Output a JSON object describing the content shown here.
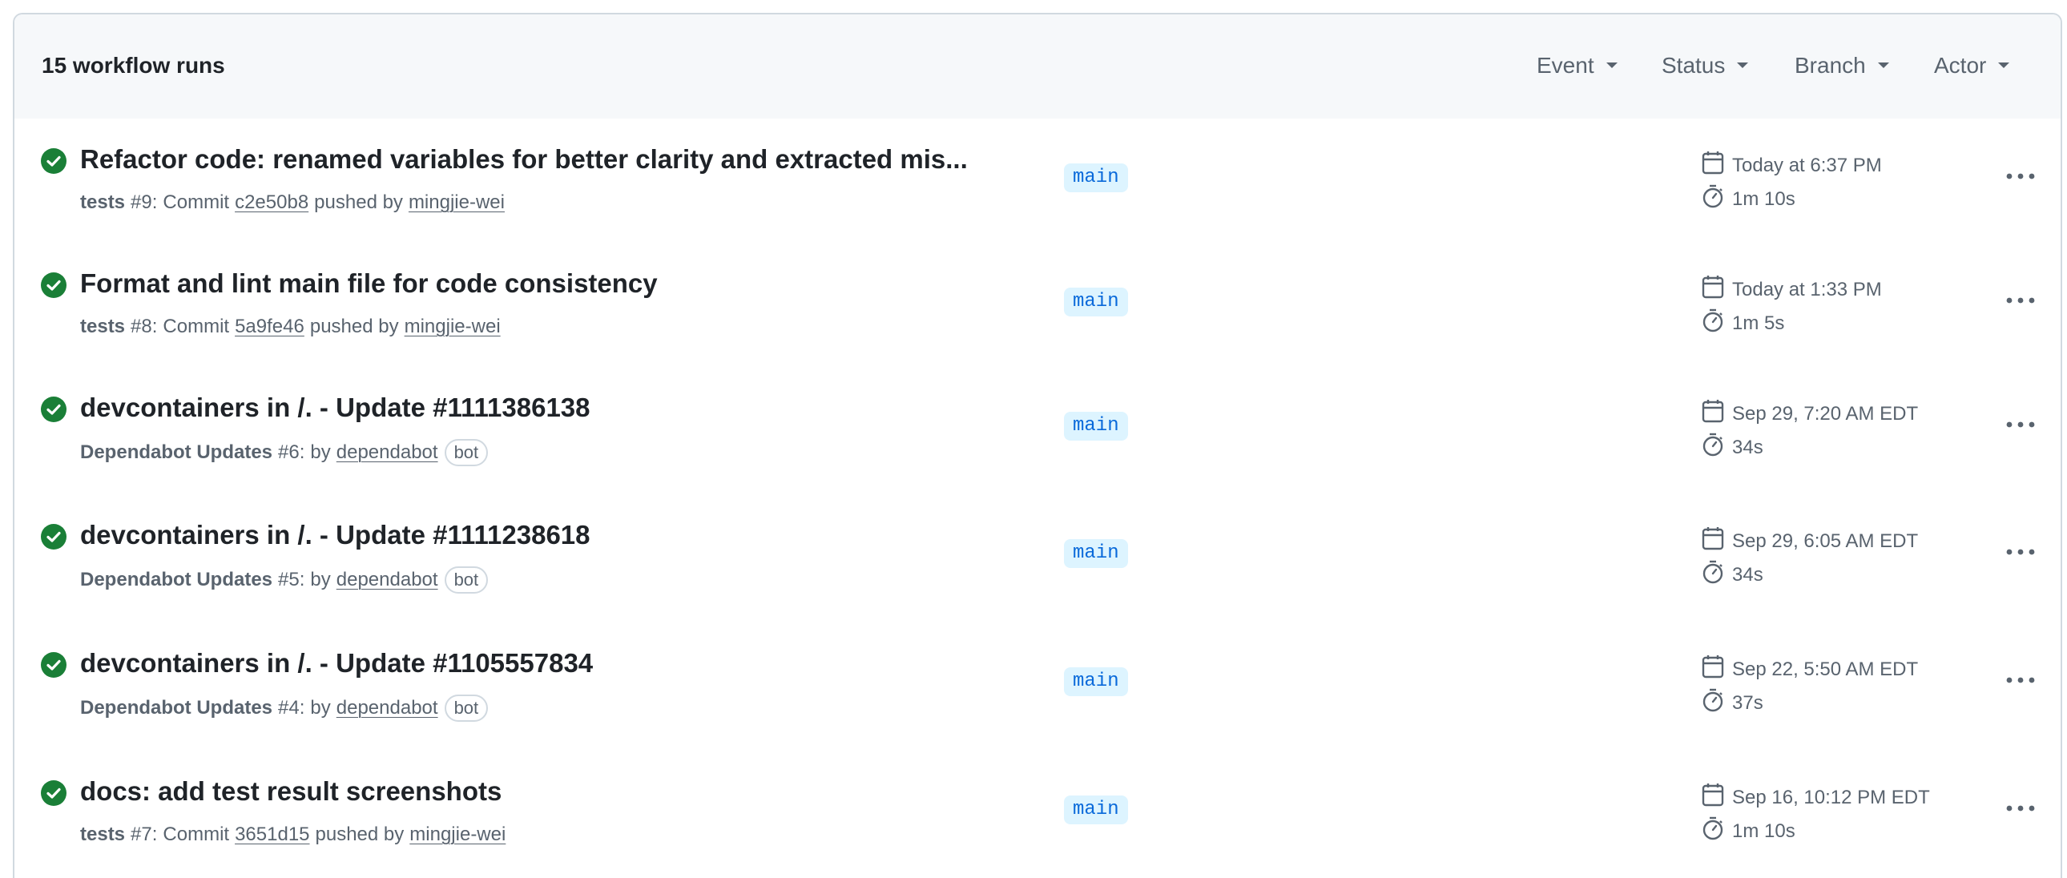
{
  "header": {
    "runs_count": "15 workflow runs",
    "filters": [
      "Event",
      "Status",
      "Branch",
      "Actor"
    ]
  },
  "runs": [
    {
      "title": "Refactor code: renamed variables for better clarity and extracted mis...",
      "workflow": "tests",
      "run_number": "#9",
      "trigger": "Commit",
      "commit": "c2e50b8",
      "action": "pushed by",
      "actor": "mingjie-wei",
      "branch": "main",
      "date": "Today at 6:37 PM",
      "duration": "1m 10s"
    },
    {
      "title": "Format and lint main file for code consistency",
      "workflow": "tests",
      "run_number": "#8",
      "trigger": "Commit",
      "commit": "5a9fe46",
      "action": "pushed by",
      "actor": "mingjie-wei",
      "branch": "main",
      "date": "Today at 1:33 PM",
      "duration": "1m 5s"
    },
    {
      "title": "devcontainers in /. - Update #1111386138",
      "workflow": "Dependabot Updates",
      "run_number": "#6",
      "action": "by",
      "actor": "dependabot",
      "badge": "bot",
      "branch": "main",
      "date": "Sep 29, 7:20 AM EDT",
      "duration": "34s"
    },
    {
      "title": "devcontainers in /. - Update #1111238618",
      "workflow": "Dependabot Updates",
      "run_number": "#5",
      "action": "by",
      "actor": "dependabot",
      "badge": "bot",
      "branch": "main",
      "date": "Sep 29, 6:05 AM EDT",
      "duration": "34s"
    },
    {
      "title": "devcontainers in /. - Update #1105557834",
      "workflow": "Dependabot Updates",
      "run_number": "#4",
      "action": "by",
      "actor": "dependabot",
      "badge": "bot",
      "branch": "main",
      "date": "Sep 22, 5:50 AM EDT",
      "duration": "37s"
    },
    {
      "title": "docs: add test result screenshots",
      "workflow": "tests",
      "run_number": "#7",
      "trigger": "Commit",
      "commit": "3651d15",
      "action": "pushed by",
      "actor": "mingjie-wei",
      "branch": "main",
      "date": "Sep 16, 10:12 PM EDT",
      "duration": "1m 10s"
    }
  ],
  "icons": {
    "status": "check-circle-fill-icon",
    "date": "calendar-icon",
    "duration": "stopwatch-icon",
    "menu": "kebab-horizontal-icon",
    "caret": "triangle-down-icon"
  },
  "colors": {
    "success": "#1a7f37",
    "branch_bg": "#ddf4ff",
    "branch_fg": "#0969da",
    "muted": "#59636e",
    "border": "#d1d9e0"
  }
}
